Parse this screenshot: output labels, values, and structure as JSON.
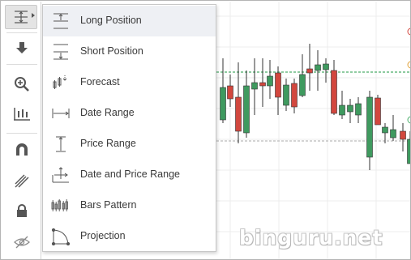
{
  "toolbar": {
    "tools": [
      {
        "name": "measure-tool-icon",
        "selected": true,
        "has_submenu": true
      },
      {
        "name": "arrow-down-icon"
      },
      {
        "name": "zoom-in-icon"
      },
      {
        "name": "ruler-icon"
      },
      {
        "name": "magnet-icon"
      },
      {
        "name": "pencil-icon"
      },
      {
        "name": "lock-icon"
      },
      {
        "name": "eye-hidden-icon"
      }
    ]
  },
  "menu": {
    "items": [
      {
        "label": "Long Position",
        "icon": "long-position-icon",
        "highlighted": true
      },
      {
        "label": "Short Position",
        "icon": "short-position-icon"
      },
      {
        "label": "Forecast",
        "icon": "forecast-icon"
      },
      {
        "label": "Date Range",
        "icon": "date-range-icon"
      },
      {
        "label": "Price Range",
        "icon": "price-range-icon"
      },
      {
        "label": "Date and Price Range",
        "icon": "date-price-range-icon"
      },
      {
        "label": "Bars Pattern",
        "icon": "bars-pattern-icon"
      },
      {
        "label": "Projection",
        "icon": "projection-icon"
      }
    ]
  },
  "colors": {
    "up_candle": "#3f9a5f",
    "down_candle": "#d2473e",
    "price_line": "#4cae6b",
    "grid": "#e6e6e6"
  },
  "watermark": "binguru.net"
}
